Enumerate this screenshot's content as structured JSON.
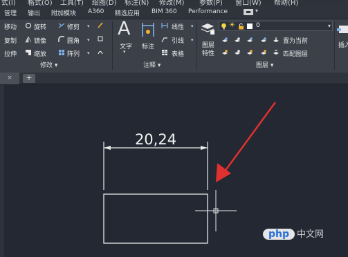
{
  "menubar": {
    "items": [
      "式(I)",
      "格式(O)",
      "工具(T)",
      "绘图(D)",
      "标注(N)",
      "修改(M)",
      "参数(P)",
      "窗口(W)",
      "帮助(H)"
    ]
  },
  "ribbon_tabs": {
    "items": [
      "管理",
      "输出",
      "附加模块",
      "A360",
      "精选应用",
      "BIM 360",
      "Performance"
    ],
    "dropdown": "▾"
  },
  "modify_panel": {
    "title": "修改 ▾",
    "move": "移动",
    "rotate": "旋转",
    "trim": "修剪",
    "copy": "复制",
    "mirror": "镜像",
    "fillet": "圆角",
    "stretch": "拉伸",
    "scale": "缩放",
    "array": "阵列"
  },
  "annotation_panel": {
    "title": "注释 ▾",
    "text_glyph": "A",
    "text": "文字",
    "dimension": "标注",
    "linear": "线性",
    "leader": "引线",
    "table": "表格"
  },
  "layers_panel": {
    "title": "图层 ▾",
    "layer_properties_line1": "图层",
    "layer_properties_line2": "特性",
    "current_layer": "0",
    "set_current": "置为当前",
    "match_layer": "匹配图层"
  },
  "insert_panel": {
    "label": "插入"
  },
  "doc_tabs": {
    "close_glyph": "×",
    "new_glyph": "+"
  },
  "drawing": {
    "dimension_text": "20,24"
  },
  "colors": {
    "ribbon_bg": "#3b4049",
    "canvas_bg": "#232833",
    "arrow": "#e03030",
    "line": "#e8e8e8",
    "watermark_blue": "#2a6fd6"
  },
  "watermark": {
    "logo": "php",
    "text": "中文网"
  }
}
